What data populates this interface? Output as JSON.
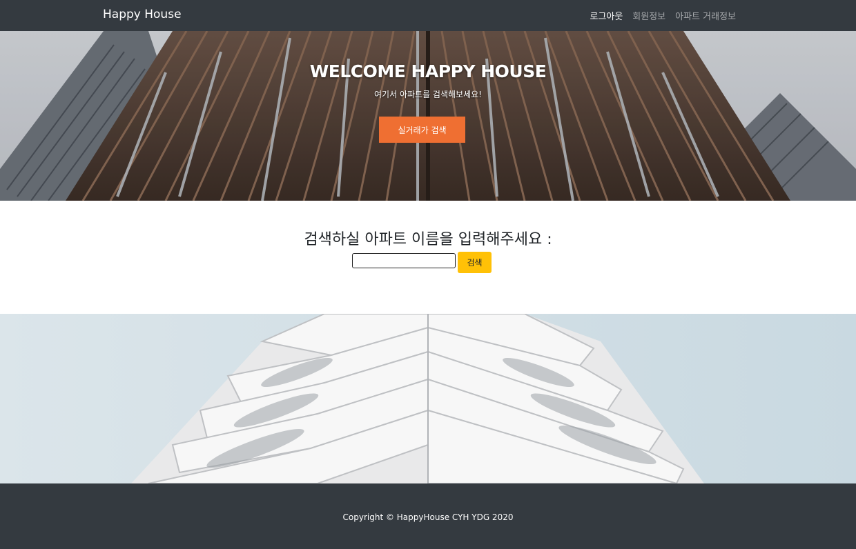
{
  "navbar": {
    "brand": "Happy House",
    "links": [
      {
        "label": "로그아웃",
        "active": true
      },
      {
        "label": "회원정보",
        "active": false
      },
      {
        "label": "아파트 거래정보",
        "active": false
      }
    ]
  },
  "hero": {
    "title": "WELCOME HAPPY HOUSE",
    "subtitle": "여기서 아파트를 검색해보세요!",
    "button_label": "실거래가 검색"
  },
  "search": {
    "heading": "검색하실 아파트 이름을 입력해주세요 :",
    "input_value": "",
    "button_label": "검색"
  },
  "footer": {
    "copyright": "Copyright © HappyHouse CYH YDG 2020"
  },
  "colors": {
    "navbar_bg": "#343a40",
    "hero_button": "#ef6f32",
    "search_button": "#ffc107",
    "footer_bg": "#343a40"
  }
}
